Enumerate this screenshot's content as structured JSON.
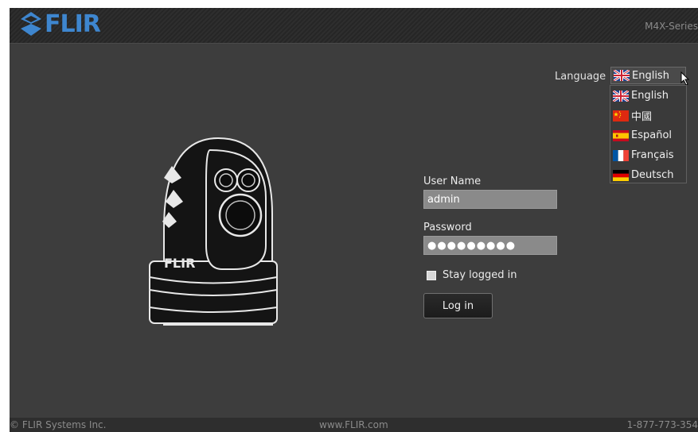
{
  "header": {
    "brand": "FLIR",
    "series": "M4X-Series"
  },
  "language": {
    "label": "Language",
    "selected": "English",
    "options": [
      "English",
      "中國",
      "Español",
      "Français",
      "Deutsch"
    ]
  },
  "login": {
    "username_label": "User Name",
    "username_value": "admin",
    "password_label": "Password",
    "password_value": "●●●●●●●●●",
    "stay_logged_in": "Stay logged in",
    "login_button": "Log in"
  },
  "camera": {
    "brand_mark": "FLIR"
  },
  "footer": {
    "copyright": "© FLIR Systems Inc.",
    "website": "www.FLIR.com",
    "phone": "1-877-773-354"
  },
  "colors": {
    "brand_blue": "#3e86cf",
    "panel": "#3d3d3d",
    "input": "#8a8a8a"
  },
  "icons": [
    "flir-logo-icon",
    "uk-flag-icon",
    "china-flag-icon",
    "spain-flag-icon",
    "france-flag-icon",
    "germany-flag-icon",
    "mouse-cursor-icon",
    "checkbox-icon"
  ]
}
